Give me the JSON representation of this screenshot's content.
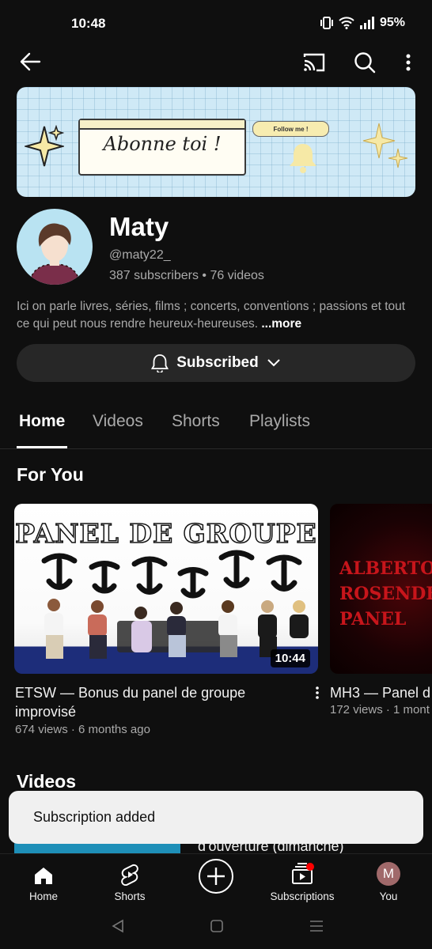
{
  "status_bar": {
    "time": "10:48",
    "battery": "95%"
  },
  "top_bar": {
    "back_icon": "arrow-left-icon",
    "cast_icon": "cast-icon",
    "search_icon": "search-icon",
    "menu_icon": "more-vert-icon"
  },
  "banner": {
    "text": "Abonne toi !",
    "follow_label": "Follow me !"
  },
  "channel": {
    "name": "Maty",
    "handle": "@maty22_",
    "stats": "387 subscribers • 76 videos",
    "description": "Ici on parle livres, séries, films ; concerts, conventions ; passions et tout ce qui peut nous rendre heureux-heureuses.",
    "more_label": "...more",
    "subscribe_label": "Subscribed"
  },
  "tabs": [
    {
      "label": "Home",
      "active": true
    },
    {
      "label": "Videos",
      "active": false
    },
    {
      "label": "Shorts",
      "active": false
    },
    {
      "label": "Playlists",
      "active": false
    }
  ],
  "for_you": {
    "title": "For You",
    "videos": [
      {
        "thumb_text": "PANEL DE GROUPE",
        "duration": "10:44",
        "title": "ETSW — Bonus du panel de groupe improvisé",
        "meta": "674 views · 6 months ago"
      },
      {
        "thumb_text": "ALBERTO\nROSENDE\nPANEL",
        "title": "MH3 — Panel d",
        "meta": "172 views · 1 mont"
      }
    ]
  },
  "videos_section": {
    "title": "Videos",
    "peek_title": "d'ouverture (dimanche)"
  },
  "toast": {
    "message": "Subscription added"
  },
  "bottom_nav": [
    {
      "label": "Home",
      "icon": "home-icon"
    },
    {
      "label": "Shorts",
      "icon": "shorts-icon"
    },
    {
      "label": "",
      "icon": "create-icon"
    },
    {
      "label": "Subscriptions",
      "icon": "subscriptions-icon"
    },
    {
      "label": "You",
      "icon": "avatar",
      "avatar_letter": "M"
    }
  ],
  "colors": {
    "background": "#0f0f0f",
    "accent_red": "#ff0000",
    "avatar_bg": "#a0696a"
  }
}
